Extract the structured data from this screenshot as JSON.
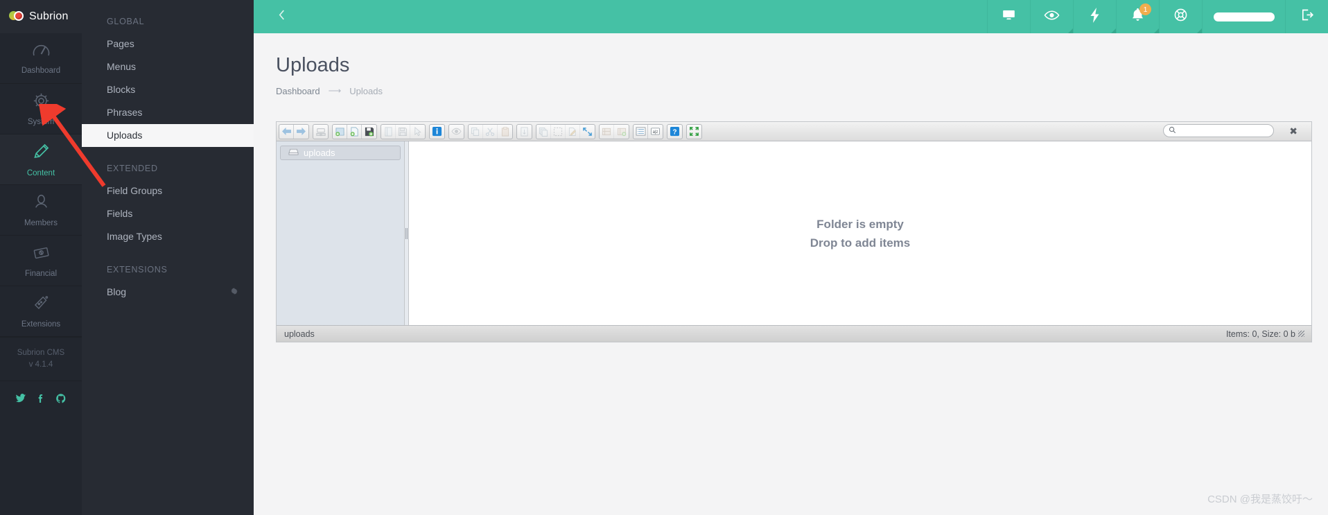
{
  "brand": {
    "name": "Subrion",
    "logo_icon": "subrion-logo-icon"
  },
  "icon_sidebar": {
    "items": [
      {
        "label": "Dashboard",
        "icon": "speedometer-icon",
        "active": false
      },
      {
        "label": "System",
        "icon": "gear-icon",
        "active": false
      },
      {
        "label": "Content",
        "icon": "pencil-icon",
        "active": true
      },
      {
        "label": "Members",
        "icon": "user-icon",
        "active": false
      },
      {
        "label": "Financial",
        "icon": "money-icon",
        "active": false
      },
      {
        "label": "Extensions",
        "icon": "flask-icon",
        "active": false
      }
    ],
    "version": {
      "product": "Subrion CMS",
      "number": "v 4.1.4"
    },
    "social": [
      {
        "name": "twitter-icon",
        "glyph": "🐦"
      },
      {
        "name": "facebook-icon",
        "glyph": "f"
      },
      {
        "name": "github-icon",
        "glyph": "●"
      }
    ]
  },
  "sub_nav": {
    "groups": [
      {
        "title": "GLOBAL",
        "items": [
          {
            "label": "Pages",
            "active": false
          },
          {
            "label": "Menus",
            "active": false
          },
          {
            "label": "Blocks",
            "active": false
          },
          {
            "label": "Phrases",
            "active": false
          },
          {
            "label": "Uploads",
            "active": true
          }
        ]
      },
      {
        "title": "EXTENDED",
        "items": [
          {
            "label": "Field Groups",
            "active": false
          },
          {
            "label": "Fields",
            "active": false
          },
          {
            "label": "Image Types",
            "active": false
          }
        ]
      },
      {
        "title": "EXTENSIONS",
        "items": [
          {
            "label": "Blog",
            "active": false,
            "has_gear": true
          }
        ]
      }
    ]
  },
  "topbar": {
    "collapse_icon": "chevron-left-icon",
    "accent_color": "#45c1a5",
    "buttons": [
      {
        "name": "view-site-icon",
        "label": "",
        "badge": ""
      },
      {
        "name": "preview-eye-icon",
        "label": "",
        "badge": ""
      },
      {
        "name": "quick-actions-bolt-icon",
        "label": "",
        "badge": ""
      },
      {
        "name": "notifications-bell-icon",
        "label": "",
        "badge": "1"
      },
      {
        "name": "help-lifebuoy-icon",
        "label": "",
        "badge": ""
      },
      {
        "name": "user-account-menu",
        "label": "",
        "badge": ""
      },
      {
        "name": "logout-icon",
        "label": "",
        "badge": ""
      }
    ],
    "badge_color": "#f0ad4e"
  },
  "page": {
    "title": "Uploads",
    "breadcrumb": {
      "root": "Dashboard",
      "separator": "⟶",
      "current": "Uploads"
    }
  },
  "filemanager": {
    "toolbar_groups": [
      {
        "buttons": [
          {
            "name": "back-icon",
            "disabled": false
          },
          {
            "name": "forward-icon",
            "disabled": false
          }
        ]
      },
      {
        "buttons": [
          {
            "name": "upload-icon",
            "disabled": true
          }
        ]
      },
      {
        "buttons": [
          {
            "name": "new-folder-icon",
            "disabled": false
          },
          {
            "name": "new-file-icon",
            "disabled": false
          },
          {
            "name": "save-icon",
            "disabled": false
          }
        ]
      },
      {
        "buttons": [
          {
            "name": "open-icon",
            "disabled": true
          },
          {
            "name": "floppy-save-icon",
            "disabled": true
          },
          {
            "name": "select-cursor-icon",
            "disabled": true
          }
        ]
      },
      {
        "buttons": [
          {
            "name": "info-icon",
            "disabled": false
          }
        ]
      },
      {
        "buttons": [
          {
            "name": "preview-icon",
            "disabled": true
          }
        ]
      },
      {
        "buttons": [
          {
            "name": "copy-icon",
            "disabled": true
          },
          {
            "name": "cut-scissors-icon",
            "disabled": true
          },
          {
            "name": "paste-clipboard-icon",
            "disabled": true
          }
        ]
      },
      {
        "buttons": [
          {
            "name": "extract-archive-icon",
            "disabled": true
          }
        ]
      },
      {
        "buttons": [
          {
            "name": "duplicate-icon",
            "disabled": true
          },
          {
            "name": "select-all-icon",
            "disabled": true
          },
          {
            "name": "rename-icon",
            "disabled": true
          },
          {
            "name": "resize-icon",
            "disabled": false
          }
        ]
      },
      {
        "buttons": [
          {
            "name": "archive-icon",
            "disabled": true
          },
          {
            "name": "add-to-archive-icon",
            "disabled": true
          }
        ]
      },
      {
        "buttons": [
          {
            "name": "list-view-icon",
            "disabled": false
          },
          {
            "name": "sort-az-icon",
            "disabled": false
          }
        ]
      },
      {
        "buttons": [
          {
            "name": "help-question-icon",
            "disabled": false
          }
        ]
      },
      {
        "buttons": [
          {
            "name": "fullscreen-icon",
            "disabled": false
          }
        ]
      }
    ],
    "search": {
      "value": "",
      "placeholder": "",
      "icon": "search-icon"
    },
    "close_label": "✖",
    "tree": {
      "root": {
        "label": "uploads",
        "icon": "folder-drive-icon"
      }
    },
    "empty_state": {
      "line1": "Folder is empty",
      "line2": "Drop to add items"
    },
    "status": {
      "path": "uploads",
      "summary": "Items: 0, Size: 0 b"
    }
  },
  "annotation": {
    "arrow_color": "#ef3b2d",
    "points_to": "sidebar-item-uploads"
  },
  "watermark": {
    "text": "CSDN @我是蒸饺吁～"
  }
}
